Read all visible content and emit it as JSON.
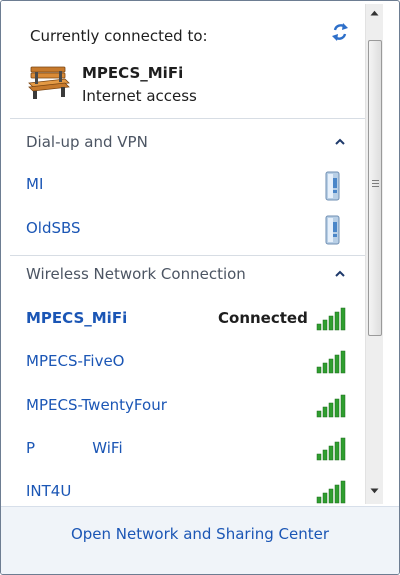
{
  "header": {
    "title": "Currently connected to:",
    "connection_name": "MPECS_MiFi",
    "connection_status": "Internet access",
    "refresh_icon": "refresh-icon"
  },
  "dialup_section": {
    "label": "Dial-up and VPN",
    "items": [
      {
        "name": "MI",
        "icon": "vpn-connection-icon"
      },
      {
        "name": "OldSBS",
        "icon": "vpn-connection-icon"
      }
    ]
  },
  "wireless_section": {
    "label": "Wireless Network Connection",
    "items": [
      {
        "name": "MPECS_MiFi",
        "status": "Connected",
        "signal": 5
      },
      {
        "name": "MPECS-FiveO",
        "status": "",
        "signal": 5
      },
      {
        "name": "MPECS-TwentyFour",
        "status": "",
        "signal": 5
      },
      {
        "name": "P            WiFi",
        "status": "",
        "signal": 5
      },
      {
        "name": "INT4U",
        "status": "",
        "signal": 5
      }
    ]
  },
  "footer": {
    "link": "Open Network and Sharing Center"
  },
  "colors": {
    "link": "#1b56b5",
    "signal_green": "#2f9e2f",
    "footer_bg": "#f0f4f9"
  }
}
